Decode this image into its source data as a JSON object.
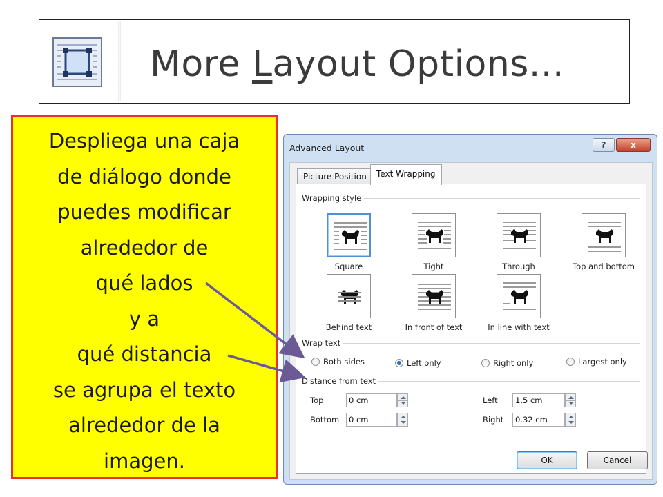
{
  "banner": {
    "text_before": "More ",
    "text_underlined": "L",
    "text_after": "ayout Options..."
  },
  "note": {
    "lines": [
      "Despliega una caja",
      "de diálogo donde",
      "puedes modificar",
      "alrededor de",
      "qué lados",
      "y  a",
      "qué distancia",
      "se agrupa el texto",
      "alrededor  de la",
      "imagen."
    ]
  },
  "dialog": {
    "title": "Advanced Layout",
    "help_label": "?",
    "close_label": "x",
    "tabs": [
      {
        "label": "Picture Position",
        "active": false
      },
      {
        "label": "Text Wrapping",
        "active": true
      }
    ],
    "wrapping_style_label": "Wrapping style",
    "wrap_options": [
      {
        "label": "Square",
        "selected": true
      },
      {
        "label": "Tight",
        "selected": false
      },
      {
        "label": "Through",
        "selected": false
      },
      {
        "label": "Top and bottom",
        "selected": false
      },
      {
        "label": "Behind text",
        "selected": false
      },
      {
        "label": "In front of text",
        "selected": false
      },
      {
        "label": "In line with text",
        "selected": false
      }
    ],
    "wrap_text_label": "Wrap text",
    "wrap_text_options": [
      {
        "label": "Both sides",
        "checked": false
      },
      {
        "label": "Left only",
        "checked": true
      },
      {
        "label": "Right only",
        "checked": false
      },
      {
        "label": "Largest only",
        "checked": false
      }
    ],
    "distance_label": "Distance from text",
    "distance": {
      "top_label": "Top",
      "top_value": "0 cm",
      "bottom_label": "Bottom",
      "bottom_value": "0 cm",
      "left_label": "Left",
      "left_value": "1.5 cm",
      "right_label": "Right",
      "right_value": "0.32 cm"
    },
    "ok_label": "OK",
    "cancel_label": "Cancel"
  },
  "colors": {
    "note_background": "#ffff00",
    "note_border": "#e8312d",
    "arrow": "#6b5a96",
    "selected_tile": "#4f8fd6"
  }
}
